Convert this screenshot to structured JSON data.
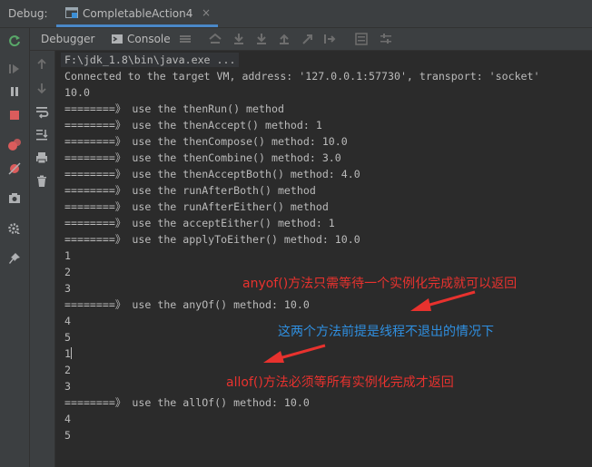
{
  "header": {
    "debug_label": "Debug:",
    "tab_title": "CompletableAction4",
    "close_glyph": "×"
  },
  "subtoolbar": {
    "debugger_tab": "Debugger",
    "console_tab": "Console"
  },
  "console": {
    "command_line": "F:\\jdk_1.8\\bin\\java.exe ...",
    "lines": [
      "Connected to the target VM, address: '127.0.0.1:57730', transport: 'socket'",
      "10.0",
      "========》 use the thenRun() method",
      "========》 use the thenAccept() method: 1",
      "========》 use the thenCompose() method: 10.0",
      "========》 use the thenCombine() method: 3.0",
      "========》 use the thenAcceptBoth() method: 4.0",
      "========》 use the runAfterBoth() method",
      "========》 use the runAfterEither() method",
      "========》 use the acceptEither() method: 1",
      "========》 use the applyToEither() method: 10.0",
      "",
      "1",
      "2",
      "3",
      "========》 use the anyOf() method: 10.0",
      "4",
      "5",
      "1",
      "2",
      "3",
      "========》 use the allOf() method: 10.0",
      "4",
      "5"
    ]
  },
  "annotations": {
    "anyof_note": "anyof()方法只需等待一个实例化完成就可以返回",
    "thread_note": "这两个方法前提是线程不退出的情况下",
    "allof_note": "allof()方法必须等所有实例化完成才返回"
  },
  "colors": {
    "annotation_red": "#e8322e",
    "annotation_blue": "#2f8fe0",
    "tab_underline": "#4a88c7",
    "console_text": "#bbbbbb"
  }
}
